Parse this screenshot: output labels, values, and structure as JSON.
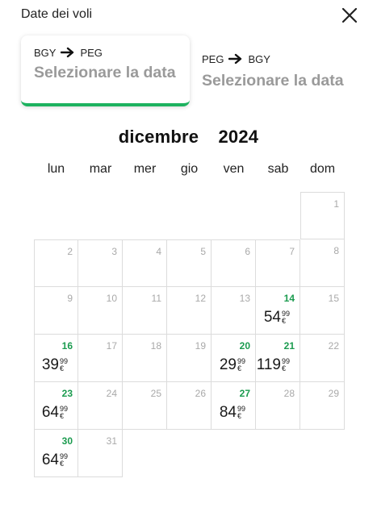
{
  "header": {
    "title": "Date dei voli",
    "close_icon": "close-icon"
  },
  "trips": [
    {
      "from": "BGY",
      "to": "PEG",
      "label": "Selezionare la data",
      "active": true
    },
    {
      "from": "PEG",
      "to": "BGY",
      "label": "Selezionare la data",
      "active": false
    }
  ],
  "calendar": {
    "month": "dicembre",
    "year": "2024",
    "weekdays": [
      "lun",
      "mar",
      "mer",
      "gio",
      "ven",
      "sab",
      "dom"
    ],
    "weeks": [
      [
        null,
        null,
        null,
        null,
        null,
        null,
        {
          "day": "1"
        }
      ],
      [
        {
          "day": "2"
        },
        {
          "day": "3"
        },
        {
          "day": "4"
        },
        {
          "day": "5"
        },
        {
          "day": "6"
        },
        {
          "day": "7"
        },
        {
          "day": "8"
        }
      ],
      [
        {
          "day": "9"
        },
        {
          "day": "10"
        },
        {
          "day": "11"
        },
        {
          "day": "12"
        },
        {
          "day": "13"
        },
        {
          "day": "14",
          "price_int": "54",
          "price_dec": "99",
          "currency": "€"
        },
        {
          "day": "15"
        }
      ],
      [
        {
          "day": "16",
          "price_int": "39",
          "price_dec": "99",
          "currency": "€"
        },
        {
          "day": "17"
        },
        {
          "day": "18"
        },
        {
          "day": "19"
        },
        {
          "day": "20",
          "price_int": "29",
          "price_dec": "99",
          "currency": "€"
        },
        {
          "day": "21",
          "price_int": "119",
          "price_dec": "99",
          "currency": "€"
        },
        {
          "day": "22"
        }
      ],
      [
        {
          "day": "23",
          "price_int": "64",
          "price_dec": "99",
          "currency": "€"
        },
        {
          "day": "24"
        },
        {
          "day": "25"
        },
        {
          "day": "26"
        },
        {
          "day": "27",
          "price_int": "84",
          "price_dec": "99",
          "currency": "€"
        },
        {
          "day": "28"
        },
        {
          "day": "29"
        }
      ],
      [
        {
          "day": "30",
          "price_int": "64",
          "price_dec": "99",
          "currency": "€"
        },
        {
          "day": "31"
        },
        null,
        null,
        null,
        null,
        null
      ]
    ]
  },
  "colors": {
    "accent": "#1db25f",
    "available_day": "#1b9b4f",
    "muted_day": "#a9a9a9",
    "placeholder": "#9a9a9a",
    "grid": "#dcdcdc"
  }
}
